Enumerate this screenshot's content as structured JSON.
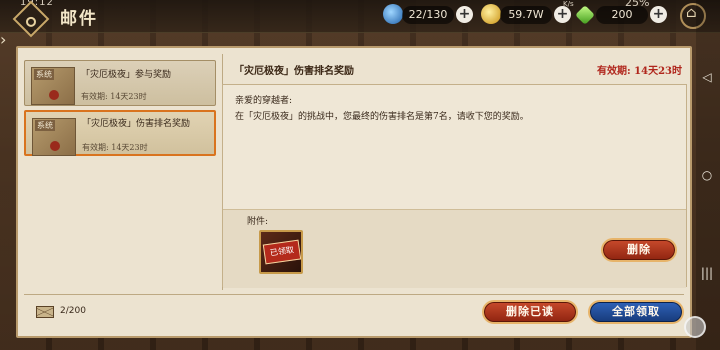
{
  "status_bar": {
    "time": "19:12",
    "net_speed": "K/s",
    "battery": "25%"
  },
  "header": {
    "title": "邮件",
    "resources": [
      {
        "name": "stamina",
        "icon": "blue-orb-icon",
        "value": "22/130",
        "color": "#3b8fd6"
      },
      {
        "name": "gold",
        "icon": "gold-coin-icon",
        "value": "59.7W",
        "color": "#e2b32a"
      },
      {
        "name": "gem",
        "icon": "green-gem-icon",
        "value": "200",
        "color": "#6fcf3a"
      }
    ]
  },
  "mail_list": [
    {
      "tag": "系统",
      "title": "「灾厄极夜」参与奖励",
      "expiry": "有效期:  14天23时",
      "selected": false
    },
    {
      "tag": "系统",
      "title": "「灾厄极夜」伤害排名奖励",
      "expiry": "有效期:  14天23时",
      "selected": true
    }
  ],
  "detail": {
    "title": "「灾厄极夜」伤害排名奖励",
    "expiry": "有效期:  14天23时",
    "greeting": "亲爱的穿越者:",
    "body": "在「灾厄极夜」的挑战中，您最终的伤害排名是第7名，请收下您的奖励。",
    "attachment_label": "附件:",
    "claimed_label": "已领取",
    "delete_label": "删除"
  },
  "footer": {
    "mail_count": "2/200",
    "delete_read_label": "删除已读",
    "claim_all_label": "全部领取"
  },
  "colors": {
    "accent_red": "#b0261c",
    "button_red": "#c84a2c",
    "button_blue": "#2f62b8",
    "panel_bg": "#ece3d0"
  }
}
